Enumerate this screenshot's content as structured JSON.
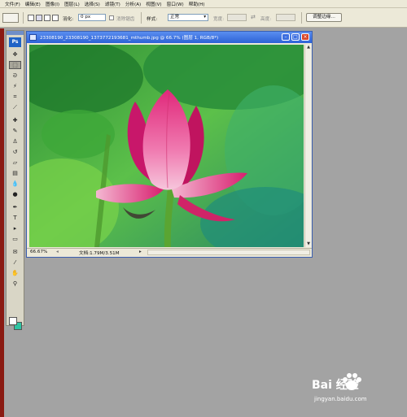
{
  "menu": [
    "文件(F)",
    "编辑(E)",
    "图像(I)",
    "图层(L)",
    "选择(S)",
    "滤镜(T)",
    "分析(A)",
    "视图(V)",
    "窗口(W)",
    "帮助(H)"
  ],
  "options": {
    "feather_label": "羽化:",
    "feather_value": "0 px",
    "antialias_label": "消除锯齿",
    "style_label": "样式:",
    "style_value": "正常",
    "width_label": "宽度:",
    "height_label": "高度:",
    "refine_edge_button": "调整边缘..."
  },
  "toolbox": {
    "logo": "Ps",
    "tools": [
      {
        "name": "move-tool",
        "glyph": "✥"
      },
      {
        "name": "marquee-tool",
        "glyph": "⬚"
      },
      {
        "name": "lasso-tool",
        "glyph": "ᘐ"
      },
      {
        "name": "magic-wand-tool",
        "glyph": "⚡"
      },
      {
        "name": "crop-tool",
        "glyph": "⌗"
      },
      {
        "name": "slice-tool",
        "glyph": "⟋"
      },
      {
        "name": "healing-brush-tool",
        "glyph": "✚"
      },
      {
        "name": "brush-tool",
        "glyph": "✎"
      },
      {
        "name": "clone-stamp-tool",
        "glyph": "♙"
      },
      {
        "name": "history-brush-tool",
        "glyph": "↺"
      },
      {
        "name": "eraser-tool",
        "glyph": "▱"
      },
      {
        "name": "gradient-tool",
        "glyph": "▤"
      },
      {
        "name": "blur-tool",
        "glyph": "💧"
      },
      {
        "name": "dodge-tool",
        "glyph": "●"
      },
      {
        "name": "pen-tool",
        "glyph": "✒"
      },
      {
        "name": "type-tool",
        "glyph": "T"
      },
      {
        "name": "path-selection-tool",
        "glyph": "▸"
      },
      {
        "name": "shape-tool",
        "glyph": "▭"
      },
      {
        "name": "notes-tool",
        "glyph": "✉"
      },
      {
        "name": "eyedropper-tool",
        "glyph": "⁄"
      },
      {
        "name": "hand-tool",
        "glyph": "✋"
      },
      {
        "name": "zoom-tool",
        "glyph": "⚲"
      }
    ]
  },
  "document": {
    "title": "23308190_23308190_1373772193681_mthumb.jpg @ 66.7% (图层 1, RGB/8*)",
    "zoom": "66.67%",
    "doc_info": "文档:1.79M/3.51M"
  },
  "watermark": {
    "brand": "Bai 经验",
    "url": "jingyan.baidu.com"
  }
}
